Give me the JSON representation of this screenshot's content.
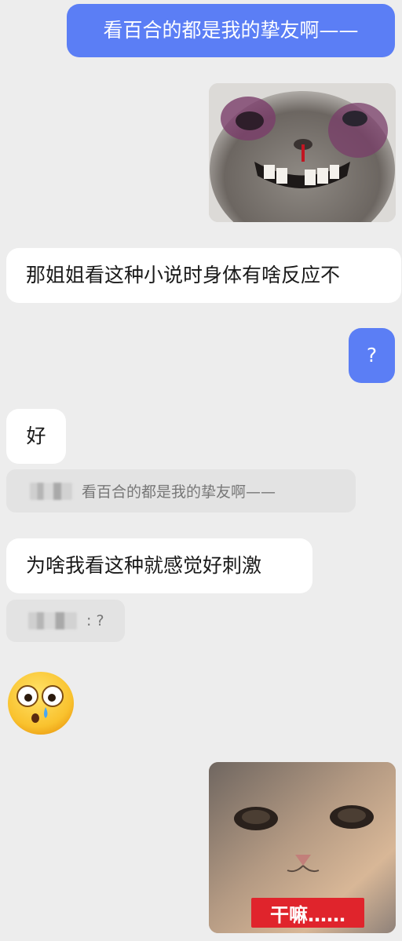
{
  "messages": {
    "m1": "看百合的都是我的挚友啊——",
    "m3": "那姐姐看这种小说时身体有啥反应不",
    "m4": "?",
    "m5": "好",
    "quote1": "看百合的都是我的挚友啊——",
    "m6": "为啥我看这种就感觉好刺激",
    "quote2": ": ?",
    "sticker2_caption": "干嘛……"
  },
  "colors": {
    "background": "#ededed",
    "outgoing_bubble": "#5b7ef5",
    "incoming_bubble": "#ffffff",
    "quote_bubble": "#e3e3e3",
    "caption_red": "#e0242c"
  },
  "icons": {
    "emoji": "flushed-emoji-icon"
  }
}
